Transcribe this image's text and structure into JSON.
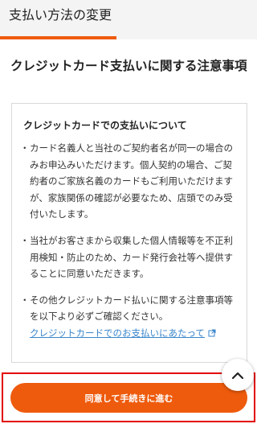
{
  "header": {
    "title": "支払い方法の変更"
  },
  "section": {
    "title": "クレジットカード支払いに関する注意事項"
  },
  "notice": {
    "heading": "クレジットカードでの支払いについて",
    "bullet": "・",
    "items": [
      {
        "text": "カード名義人と当社のご契約者名が同一の場合のみお申込みいただけます。個人契約の場合、ご契約者のご家族名義のカードもご利用いただけますが、家族関係の確認が必要なため、店頭でのみ受付いたします。"
      },
      {
        "text": "当社がお客さまから収集した個人情報等を不正利用検知・防止のため、カード発行会社等へ提供することに同意いただきます。"
      },
      {
        "text": "その他クレジットカード払いに関する注意事項等を以下より必ずご確認ください。",
        "link": "クレジットカードでのお支払いにあたって"
      }
    ]
  },
  "actions": {
    "agree_button": "同意して手続きに進む"
  },
  "icons": {
    "external": "external-link-icon",
    "scroll_top": "chevron-up-icon"
  },
  "colors": {
    "accent": "#ee5b0d",
    "link": "#3a86cc",
    "highlight": "#e30000"
  }
}
